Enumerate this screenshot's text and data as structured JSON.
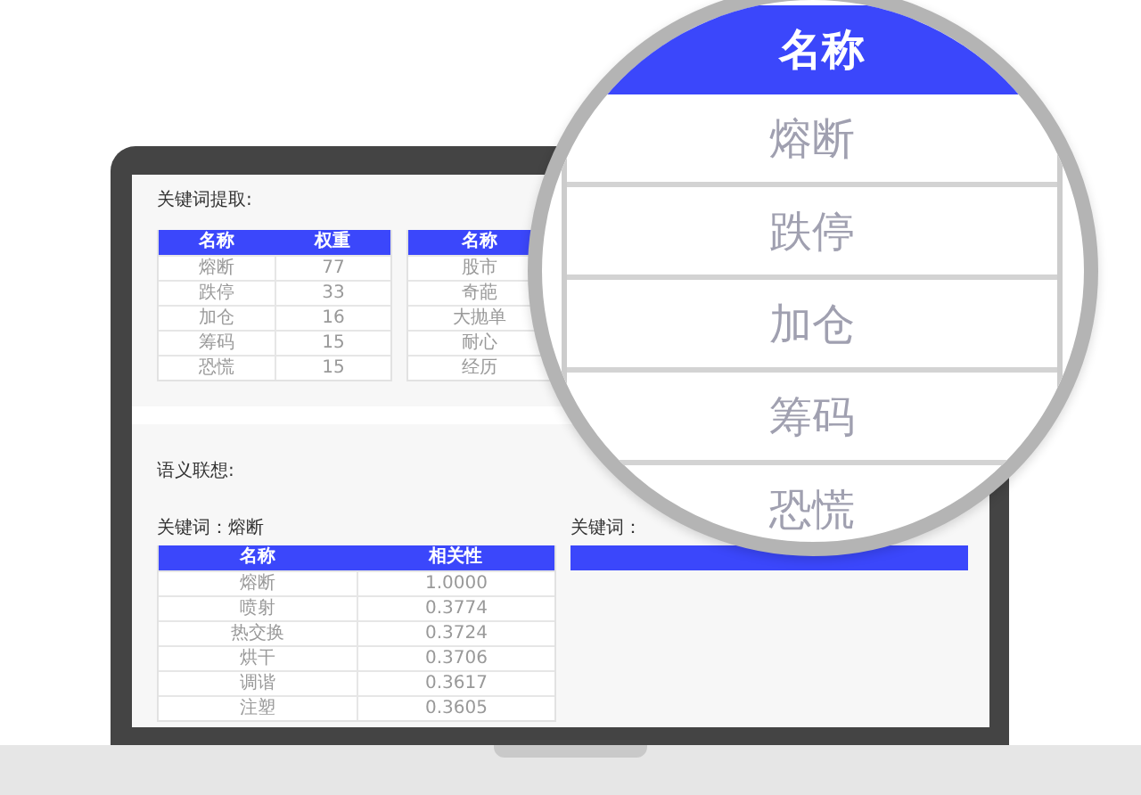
{
  "keyword_extraction": {
    "title": "关键词提取:",
    "tables": [
      {
        "columns": [
          "名称",
          "权重"
        ],
        "rows": [
          [
            "熔断",
            "77"
          ],
          [
            "跌停",
            "33"
          ],
          [
            "加仓",
            "16"
          ],
          [
            "筹码",
            "15"
          ],
          [
            "恐慌",
            "15"
          ]
        ]
      },
      {
        "columns": [
          "名称"
        ],
        "rows": [
          [
            "股市"
          ],
          [
            "奇葩"
          ],
          [
            "大抛单"
          ],
          [
            "耐心"
          ],
          [
            "经历"
          ]
        ]
      }
    ]
  },
  "semantic_association": {
    "title": "语义联想:",
    "groups": [
      {
        "keyword_label": "关键词：熔断",
        "columns": [
          "名称",
          "相关性"
        ],
        "rows": [
          [
            "熔断",
            "1.0000"
          ],
          [
            "喷射",
            "0.3774"
          ],
          [
            "热交换",
            "0.3724"
          ],
          [
            "烘干",
            "0.3706"
          ],
          [
            "调谐",
            "0.3617"
          ],
          [
            "注塑",
            "0.3605"
          ]
        ]
      },
      {
        "keyword_label": "关键词："
      }
    ]
  },
  "magnifier": {
    "header": "名称",
    "rows": [
      "熔断",
      "跌停",
      "加仓",
      "筹码",
      "恐慌"
    ]
  }
}
